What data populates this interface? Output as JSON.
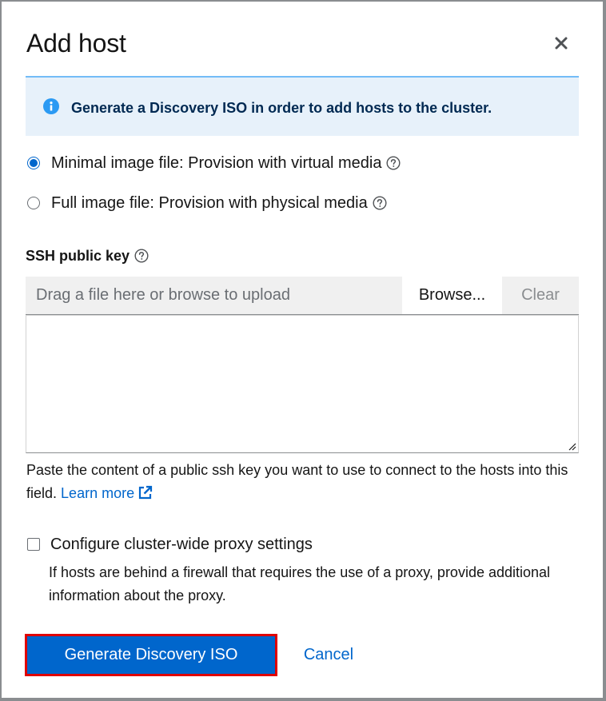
{
  "modal": {
    "title": "Add host",
    "close_icon": "close-icon"
  },
  "alert": {
    "icon": "info-circle-icon",
    "text": "Generate a Discovery ISO in order to add hosts to the cluster."
  },
  "image_type": {
    "options": [
      {
        "label": "Minimal image file: Provision with virtual media",
        "checked": true
      },
      {
        "label": "Full image file: Provision with physical media",
        "checked": false
      }
    ]
  },
  "ssh_key": {
    "label": "SSH public key",
    "placeholder": "Drag a file here or browse to upload",
    "browse_label": "Browse...",
    "clear_label": "Clear",
    "value": "",
    "helper_text": "Paste the content of a public ssh key you want to use to connect to the hosts into this field.",
    "learn_more": "Learn more"
  },
  "proxy": {
    "label": "Configure cluster-wide proxy settings",
    "description": "If hosts are behind a firewall that requires the use of a proxy, provide additional information about the proxy.",
    "checked": false
  },
  "footer": {
    "primary_label": "Generate Discovery ISO",
    "cancel_label": "Cancel"
  },
  "colors": {
    "primary": "#0066cc",
    "alert_bg": "#e7f1fa",
    "highlight_border": "#e00000"
  }
}
